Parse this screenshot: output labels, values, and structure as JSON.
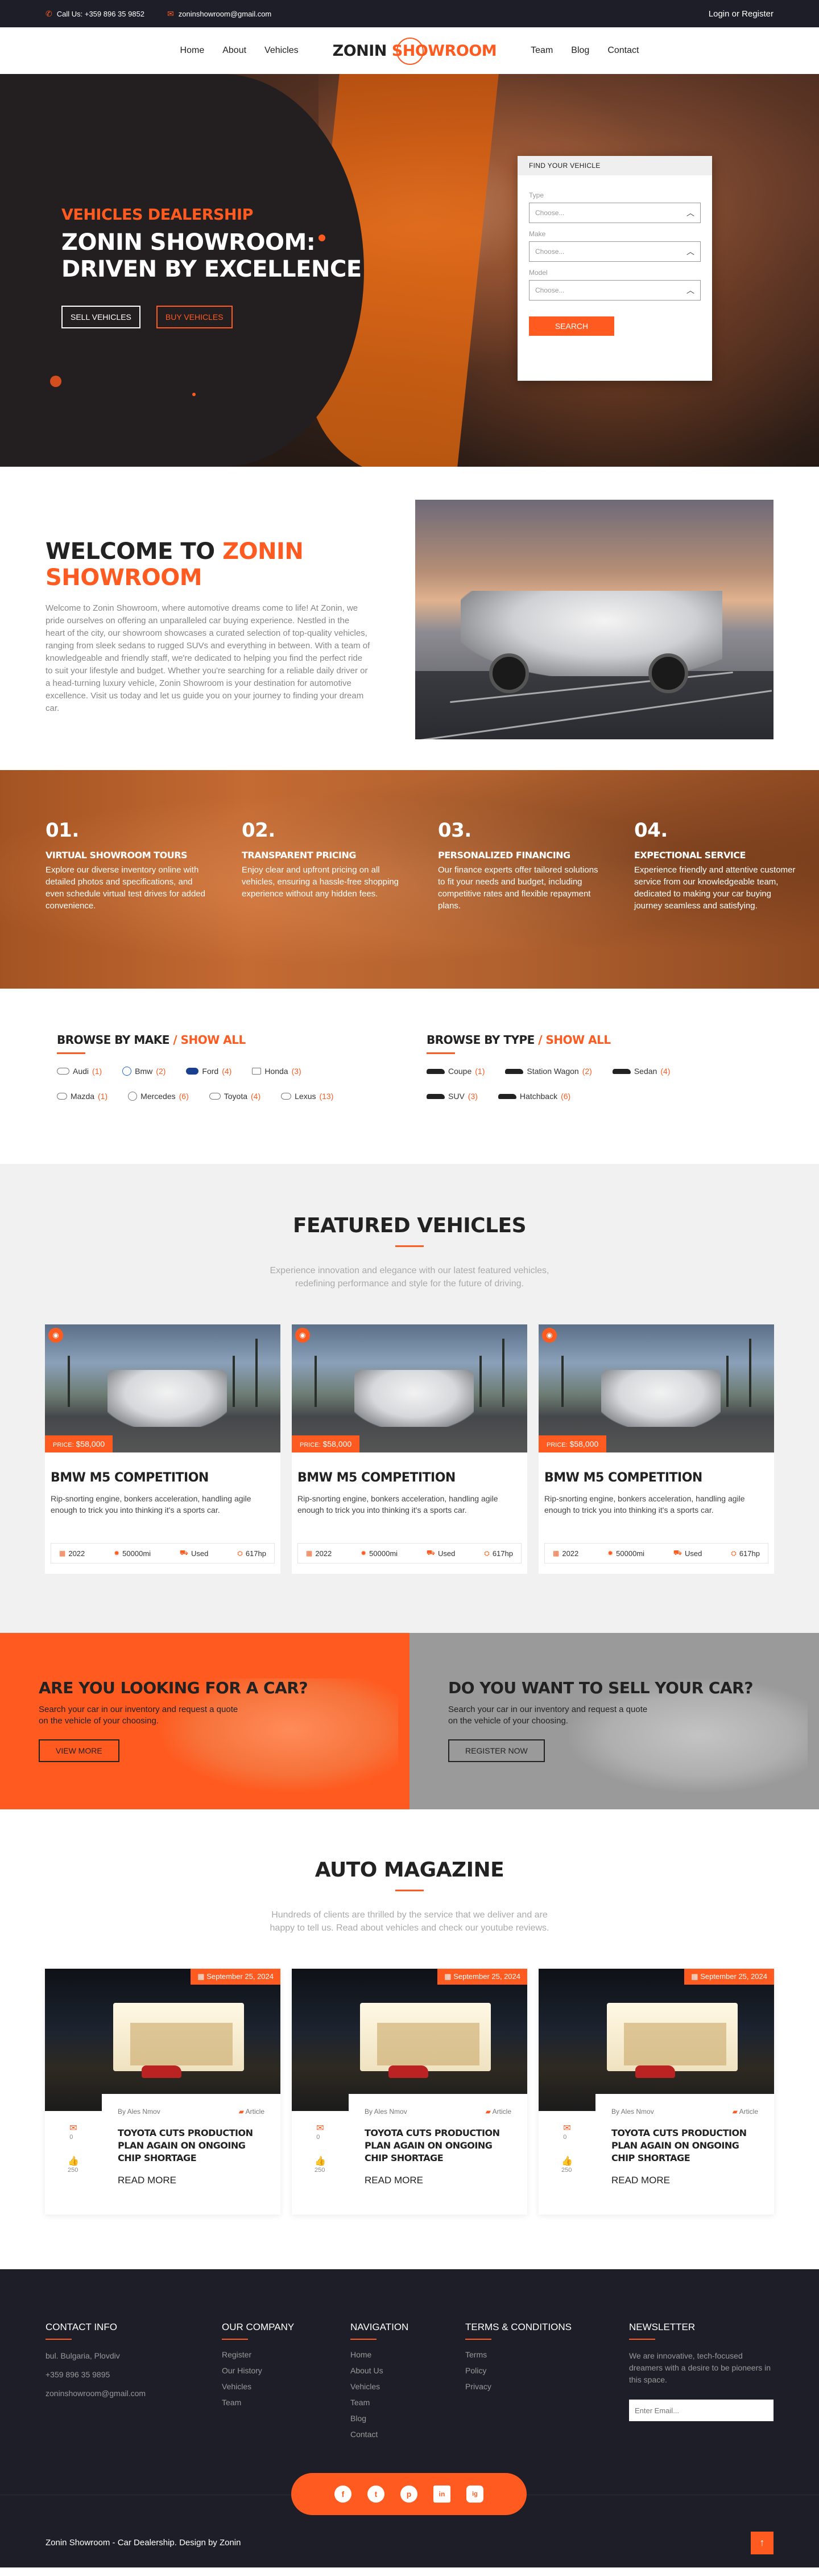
{
  "topbar": {
    "phone": "Call Us: +359 896 35 9852",
    "email": "zoninshowroom@gmail.com",
    "login": "Login or Register"
  },
  "nav": {
    "left": [
      "Home",
      "About",
      "Vehicles"
    ],
    "logo_a": "ZONIN",
    "logo_b": "SHOWROOM",
    "right": [
      "Team",
      "Blog",
      "Contact"
    ]
  },
  "hero": {
    "kicker": "VEHICLES DEALERSHIP",
    "title_line1": "ZONIN SHOWROOM:",
    "title_line2": "DRIVEN BY EXCELLENCE",
    "btn_sell": "SELL VEHICLES",
    "btn_buy": "BUY VEHICLES"
  },
  "finder": {
    "title": "FIND YOUR VEHICLE",
    "fields": [
      {
        "label": "Type",
        "placeholder": "Choose..."
      },
      {
        "label": "Make",
        "placeholder": "Choose..."
      },
      {
        "label": "Model",
        "placeholder": "Choose..."
      }
    ],
    "search": "SEARCH"
  },
  "welcome": {
    "title_a": "WELCOME TO ",
    "title_b": "ZONIN SHOWROOM",
    "text": "Welcome to Zonin Showroom, where automotive dreams come to life! At Zonin, we pride ourselves on offering an unparalleled car buying experience. Nestled in the heart of the city, our showroom showcases a curated selection of top-quality vehicles, ranging from sleek sedans to rugged SUVs and everything in between. With a team of knowledgeable and friendly staff, we're dedicated to helping you find the perfect ride to suit your lifestyle and budget. Whether you're searching for a reliable daily driver or a head-turning luxury vehicle, Zonin Showroom is your destination for automotive excellence. Visit us today and let us guide you on your journey to finding your dream car."
  },
  "features": [
    {
      "num": "01.",
      "title": "VIRTUAL SHOWROOM TOURS",
      "text": "Explore our diverse inventory online with detailed photos and specifications, and even schedule virtual test drives for added convenience."
    },
    {
      "num": "02.",
      "title": "TRANSPARENT PRICING",
      "text": "Enjoy clear and upfront pricing on all vehicles, ensuring a hassle-free shopping experience without any hidden fees."
    },
    {
      "num": "03.",
      "title": "PERSONALIZED FINANCING",
      "text": "Our finance experts offer tailored solutions to fit your needs and budget, including competitive rates and flexible repayment plans."
    },
    {
      "num": "04.",
      "title": "EXPECTIONAL SERVICE",
      "text": "Experience friendly and attentive customer service from our knowledgeable team, dedicated to making your car buying journey seamless and satisfying."
    }
  ],
  "browse_make": {
    "title_a": "BROWSE BY MAKE",
    "title_b": " / SHOW ALL",
    "items": [
      {
        "name": "Audi",
        "count": "(1)"
      },
      {
        "name": "Bmw",
        "count": "(2)"
      },
      {
        "name": "Ford",
        "count": "(4)"
      },
      {
        "name": "Honda",
        "count": "(3)"
      },
      {
        "name": "Mazda",
        "count": "(1)"
      },
      {
        "name": "Mercedes",
        "count": "(6)"
      },
      {
        "name": "Toyota",
        "count": "(4)"
      },
      {
        "name": "Lexus",
        "count": "(13)"
      }
    ]
  },
  "browse_type": {
    "title_a": "BROWSE BY TYPE",
    "title_b": " / SHOW ALL",
    "items": [
      {
        "name": "Coupe",
        "count": "(1)"
      },
      {
        "name": "Station Wagon",
        "count": "(2)"
      },
      {
        "name": "Sedan",
        "count": "(4)"
      },
      {
        "name": "SUV",
        "count": "(3)"
      },
      {
        "name": "Hatchback",
        "count": "(6)"
      }
    ]
  },
  "featured": {
    "title": "FEATURED VEHICLES",
    "sub": "Experience innovation and elegance with our latest featured vehicles, redefining performance and style for the future of driving.",
    "cards": [
      {
        "price_label": "PRICE:",
        "price": "$58,000",
        "name": "BMW M5 COMPETITION",
        "desc": "Rip-snorting engine, bonkers acceleration, handling agile enough to trick you into thinking it's a sports car.",
        "year": "2022",
        "mileage": "50000mi",
        "cond": "Used",
        "power": "617hp"
      },
      {
        "price_label": "PRICE:",
        "price": "$58,000",
        "name": "BMW M5 COMPETITION",
        "desc": "Rip-snorting engine, bonkers acceleration, handling agile enough to trick you into thinking it's a sports car.",
        "year": "2022",
        "mileage": "50000mi",
        "cond": "Used",
        "power": "617hp"
      },
      {
        "price_label": "PRICE:",
        "price": "$58,000",
        "name": "BMW M5 COMPETITION",
        "desc": "Rip-snorting engine, bonkers acceleration, handling agile enough to trick you into thinking it's a sports car.",
        "year": "2022",
        "mileage": "50000mi",
        "cond": "Used",
        "power": "617hp"
      }
    ]
  },
  "cta": {
    "buy_title": "ARE YOU LOOKING FOR A CAR?",
    "buy_text": "Search your car in our inventory and request a quote on the vehicle of your choosing.",
    "buy_btn": "VIEW MORE",
    "sell_title": "DO YOU WANT TO SELL YOUR CAR?",
    "sell_text": "Search your car in our inventory and request a quote on the vehicle of your choosing.",
    "sell_btn": "REGISTER NOW"
  },
  "magazine": {
    "title": "AUTO MAGAZINE",
    "sub": "Hundreds of clients are thrilled by the service that we deliver and are happy to tell us. Read about vehicles and check our youtube reviews.",
    "posts": [
      {
        "date": "September 25, 2024",
        "author": "By Ales Nmov",
        "cat": "Article",
        "comments": "0",
        "likes": "250",
        "title": "TOYOTA CUTS PRODUCTION PLAN AGAIN ON ONGOING CHIP SHORTAGE",
        "more": "READ MORE"
      },
      {
        "date": "September 25, 2024",
        "author": "By Ales Nmov",
        "cat": "Article",
        "comments": "0",
        "likes": "250",
        "title": "TOYOTA CUTS PRODUCTION PLAN AGAIN ON ONGOING CHIP SHORTAGE",
        "more": "READ MORE"
      },
      {
        "date": "September 25, 2024",
        "author": "By Ales Nmov",
        "cat": "Article",
        "comments": "0",
        "likes": "250",
        "title": "TOYOTA CUTS PRODUCTION PLAN AGAIN ON ONGOING CHIP SHORTAGE",
        "more": "READ MORE"
      }
    ]
  },
  "footer": {
    "contact": {
      "title": "CONTACT INFO",
      "address": "bul. Bulgaria, Plovdiv",
      "phone": "+359 896 35 9895",
      "email": "zoninshowroom@gmail.com"
    },
    "company": {
      "title": "OUR COMPANY",
      "links": [
        "Register",
        "Our History",
        "Vehicles",
        "Team"
      ]
    },
    "navigation": {
      "title": "NAVIGATION",
      "links": [
        "Home",
        "About Us",
        "Vehicles",
        "Team",
        "Blog",
        "Contact"
      ]
    },
    "terms": {
      "title": "TERMS & CONDITIONS",
      "links": [
        "Terms",
        "Policy",
        "Privacy"
      ]
    },
    "newsletter": {
      "title": "NEWSLETTER",
      "text": "We are innovative, tech-focused dreamers with a desire to be pioneers in this space.",
      "placeholder": "Enter Email..."
    },
    "social": [
      "f",
      "t",
      "p",
      "in",
      "ig"
    ],
    "copyright": "Zonin Showroom - Car Dealership. Design by Zonin"
  },
  "colors": {
    "accent": "#ff5a1f",
    "dark": "#1e1e28"
  }
}
